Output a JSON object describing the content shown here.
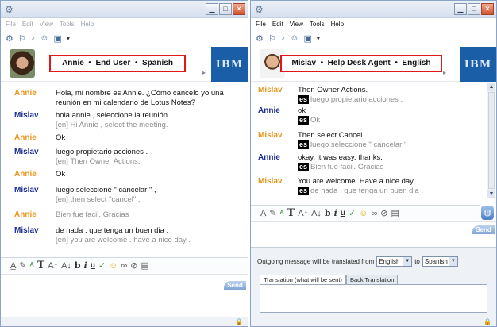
{
  "left": {
    "menu": [
      "File",
      "Edit",
      "View",
      "Tools",
      "Help"
    ],
    "header": {
      "name": "Annie",
      "role": "End User",
      "language": "Spanish",
      "sep1": "•",
      "sep2": "•"
    },
    "logo": "IBM",
    "messages": [
      {
        "speaker": "Annie",
        "text": "Hola, mi nombre es Annie. ¿Cómo cancelo yo una reunión en mi calendario de Lotus Notes?",
        "translation": "",
        "gray": false
      },
      {
        "speaker": "Mislav",
        "text": "hola annie , seleccione la reunión.",
        "translation": "[en]  Hi Annie , select the meeting.",
        "gray": false
      },
      {
        "speaker": "Annie",
        "text": "Ok",
        "translation": "",
        "gray": false
      },
      {
        "speaker": "Mislav",
        "text": "luego propietario acciones .",
        "translation": "[en]  Then Owner Actions.",
        "gray": false
      },
      {
        "speaker": "Annie",
        "text": "Ok",
        "translation": "",
        "gray": false
      },
      {
        "speaker": "Mislav",
        "text": " luego seleccione \" cancelar \" ,",
        "translation": "[en]  then select \"cancel\" ,",
        "gray": false
      },
      {
        "speaker": "Annie",
        "text": "Bien fue facil.  Gracias",
        "translation": "",
        "gray": true
      },
      {
        "speaker": "Mislav",
        "text": "de nada . que tenga un buen dia .",
        "translation": "[en]  you are welcome . have a nice day .",
        "gray": false
      }
    ],
    "send_label": "Send"
  },
  "right": {
    "menu": [
      "File",
      "Edit",
      "View",
      "Tools",
      "Help"
    ],
    "header": {
      "name": "Mislav",
      "role": "Help Desk Agent",
      "language": "English",
      "sep1": "•",
      "sep2": "•"
    },
    "logo": "IBM",
    "messages": [
      {
        "speaker": "Mislav",
        "text": "Then Owner Actions.",
        "badge": "es",
        "translation": "luego propietario acciones ."
      },
      {
        "speaker": "Annie",
        "text": "ok",
        "badge": "es",
        "translation": "Ok"
      },
      {
        "speaker": "Mislav",
        "text": "Then select Cancel.",
        "badge": "es",
        "translation": "luego seleccione \" cancelar \" ,"
      },
      {
        "speaker": "Annie",
        "text": "okay, it was easy.  thanks.",
        "badge": "es",
        "translation": "Bien fue facil.  Gracias"
      },
      {
        "speaker": "Mislav",
        "text": "You are welcome.  Have a nice day.",
        "badge": "es",
        "translation": "de nada . que tenga un buen dia ."
      }
    ],
    "send_label": "Send",
    "translation_panel": {
      "prefix": "Outgoing message will be translated from",
      "from": "English",
      "to_word": "to",
      "to": "Spanish",
      "tabs": [
        "Translation (what will be sent)",
        "Back Translation"
      ]
    }
  },
  "colors": {
    "annie": "#e8971f",
    "mislav": "#1c2f92",
    "highlight": "#e01818",
    "ibm_blue": "#1a5ea8"
  },
  "icons": [
    "app-icon",
    "minimize-icon",
    "maximize-icon",
    "close-icon",
    "contacts-icon",
    "lock-icon",
    "globe-icon"
  ]
}
